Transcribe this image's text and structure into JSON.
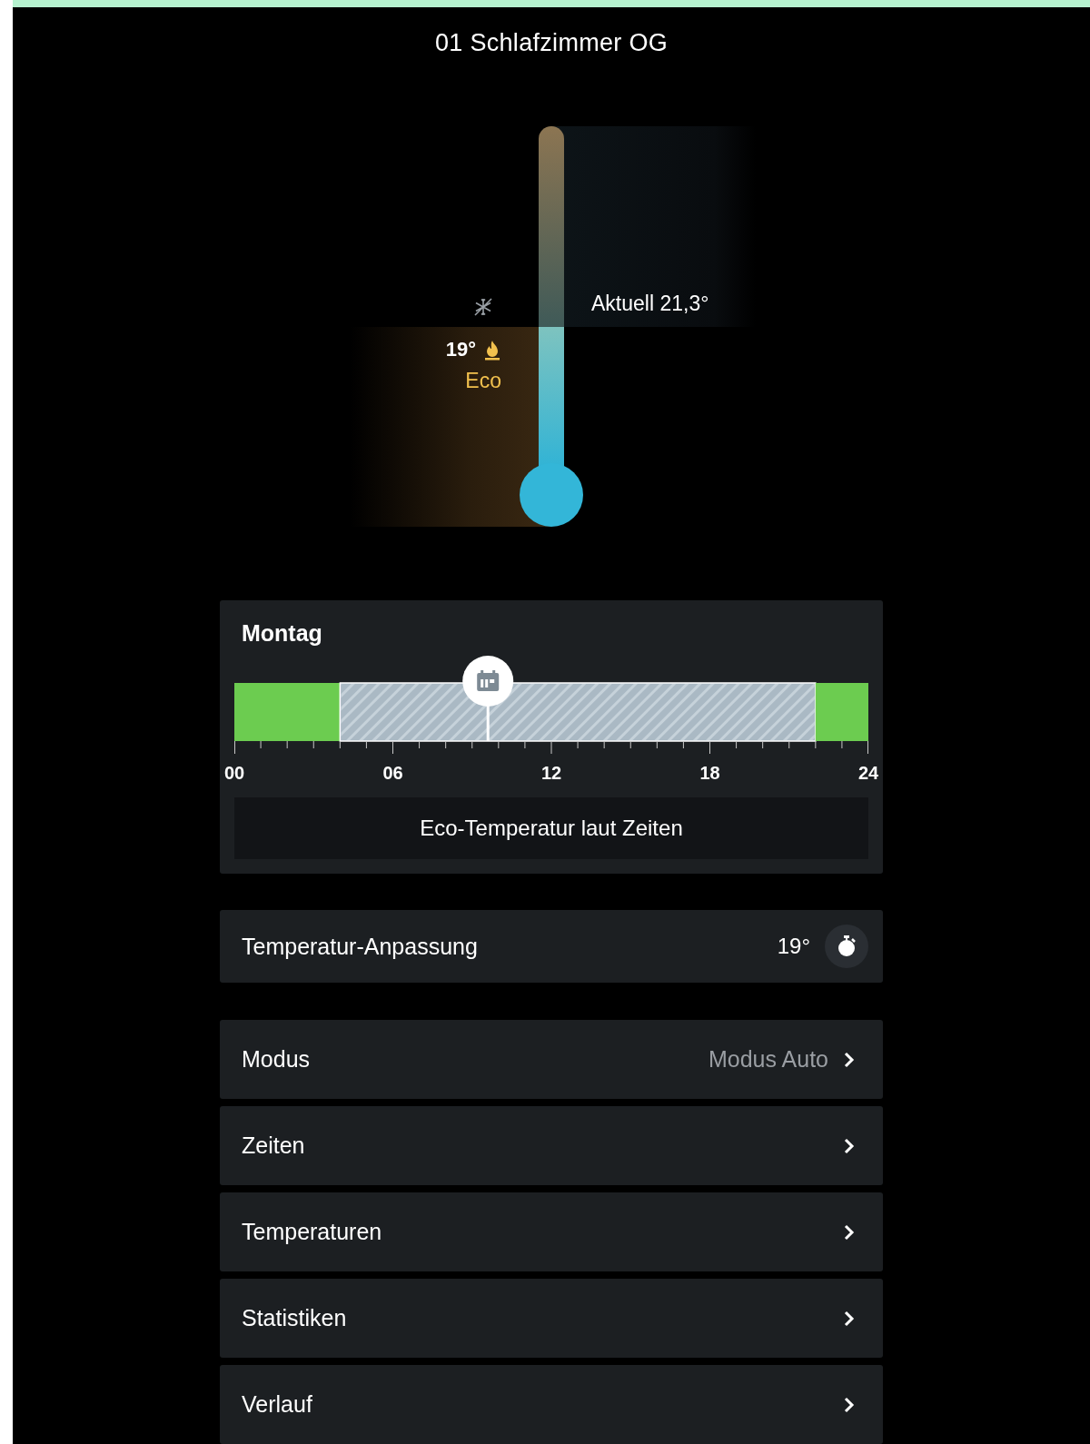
{
  "title": "01 Schlafzimmer OG",
  "thermostat": {
    "current": "Aktuell 21,3°",
    "target": "19°",
    "mode": "Eco"
  },
  "schedule": {
    "day": "Montag",
    "chart_data": {
      "type": "bar",
      "orientation": "horizontal",
      "stacked": true,
      "xlim": [
        0,
        24
      ],
      "xticks": [
        {
          "value": 0,
          "label": "00"
        },
        {
          "value": 6,
          "label": "06"
        },
        {
          "value": 12,
          "label": "12"
        },
        {
          "value": 18,
          "label": "18"
        },
        {
          "value": 24,
          "label": "24"
        }
      ],
      "series": [
        {
          "color": "#6ccc50",
          "values": [
            4
          ]
        },
        {
          "color": "#aab9c4",
          "values": [
            18
          ]
        },
        {
          "color": "#6ccc50",
          "values": [
            2
          ]
        }
      ],
      "ref_lines": [
        {
          "axis": "x",
          "value": 9.6
        }
      ]
    },
    "status": "Eco-Temperatur laut Zeiten"
  },
  "adjustment": {
    "label": "Temperatur-Anpassung",
    "value": "19°"
  },
  "menu": [
    {
      "label": "Modus",
      "value": "Modus Auto"
    },
    {
      "label": "Zeiten"
    },
    {
      "label": "Temperaturen"
    },
    {
      "label": "Statistiken"
    },
    {
      "label": "Verlauf"
    }
  ]
}
